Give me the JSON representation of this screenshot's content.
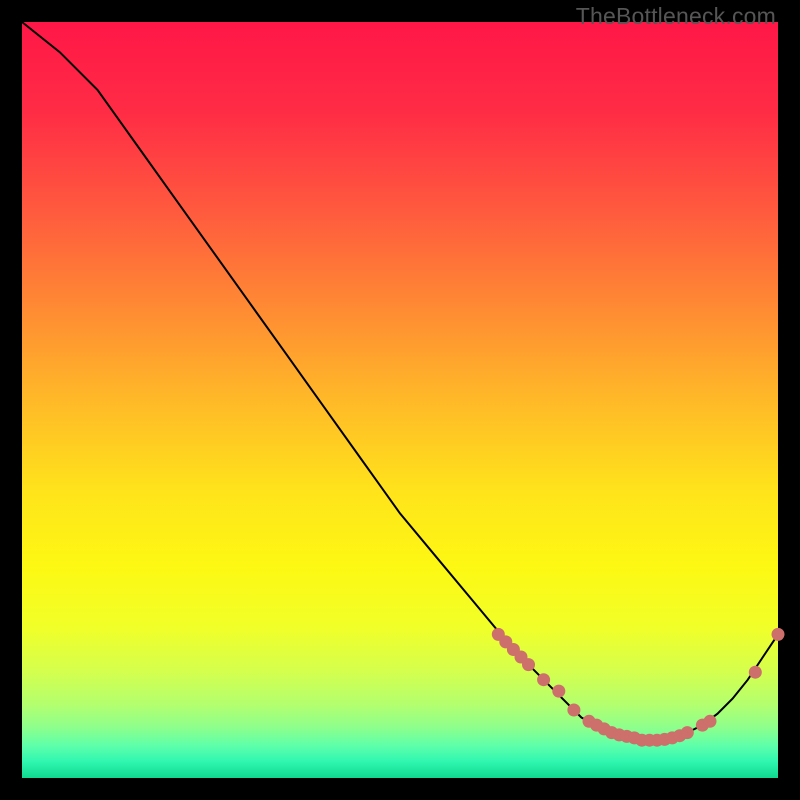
{
  "watermark": "TheBottleneck.com",
  "colors": {
    "curve": "#000000",
    "marker": "#cd6f6b",
    "gradient_stops": [
      {
        "at": 0.0,
        "hex": "#ff1747"
      },
      {
        "at": 0.12,
        "hex": "#ff2c45"
      },
      {
        "at": 0.25,
        "hex": "#ff5a3e"
      },
      {
        "at": 0.38,
        "hex": "#ff8b33"
      },
      {
        "at": 0.5,
        "hex": "#ffb928"
      },
      {
        "at": 0.62,
        "hex": "#ffe31b"
      },
      {
        "at": 0.72,
        "hex": "#fdf813"
      },
      {
        "at": 0.8,
        "hex": "#f1ff28"
      },
      {
        "at": 0.86,
        "hex": "#d4ff4e"
      },
      {
        "at": 0.905,
        "hex": "#b1ff70"
      },
      {
        "at": 0.935,
        "hex": "#8aff8e"
      },
      {
        "at": 0.958,
        "hex": "#5cffaa"
      },
      {
        "at": 0.978,
        "hex": "#30f7b0"
      },
      {
        "at": 1.0,
        "hex": "#0fd98f"
      }
    ]
  },
  "chart_data": {
    "type": "line",
    "title": "",
    "xlabel": "",
    "ylabel": "",
    "xlim": [
      0,
      100
    ],
    "ylim": [
      0,
      100
    ],
    "grid": false,
    "series": [
      {
        "name": "bottleneck-curve",
        "x": [
          0,
          5,
          10,
          15,
          20,
          25,
          30,
          35,
          40,
          45,
          50,
          55,
          60,
          65,
          68,
          70,
          72,
          74,
          76,
          78,
          80,
          82,
          84,
          86,
          88,
          90,
          92,
          94,
          96,
          98,
          100
        ],
        "values": [
          100,
          96,
          91,
          84,
          77,
          70,
          63,
          56,
          49,
          42,
          35,
          29,
          23,
          17,
          14,
          12,
          10,
          8,
          7,
          6,
          5.5,
          5,
          5,
          5.3,
          6,
          7,
          8.5,
          10.5,
          13,
          16,
          19
        ]
      }
    ],
    "markers": {
      "name": "highlight-points",
      "x": [
        63,
        64,
        65,
        66,
        67,
        69,
        71,
        73,
        75,
        76,
        77,
        78,
        79,
        80,
        81,
        82,
        83,
        84,
        85,
        86,
        87,
        88,
        90,
        91,
        97,
        100
      ],
      "values": [
        19,
        18,
        17,
        16,
        15,
        13,
        11.5,
        9,
        7.5,
        7,
        6.5,
        6,
        5.7,
        5.5,
        5.3,
        5,
        5,
        5,
        5.1,
        5.3,
        5.6,
        6,
        7,
        7.5,
        14,
        19
      ]
    }
  }
}
